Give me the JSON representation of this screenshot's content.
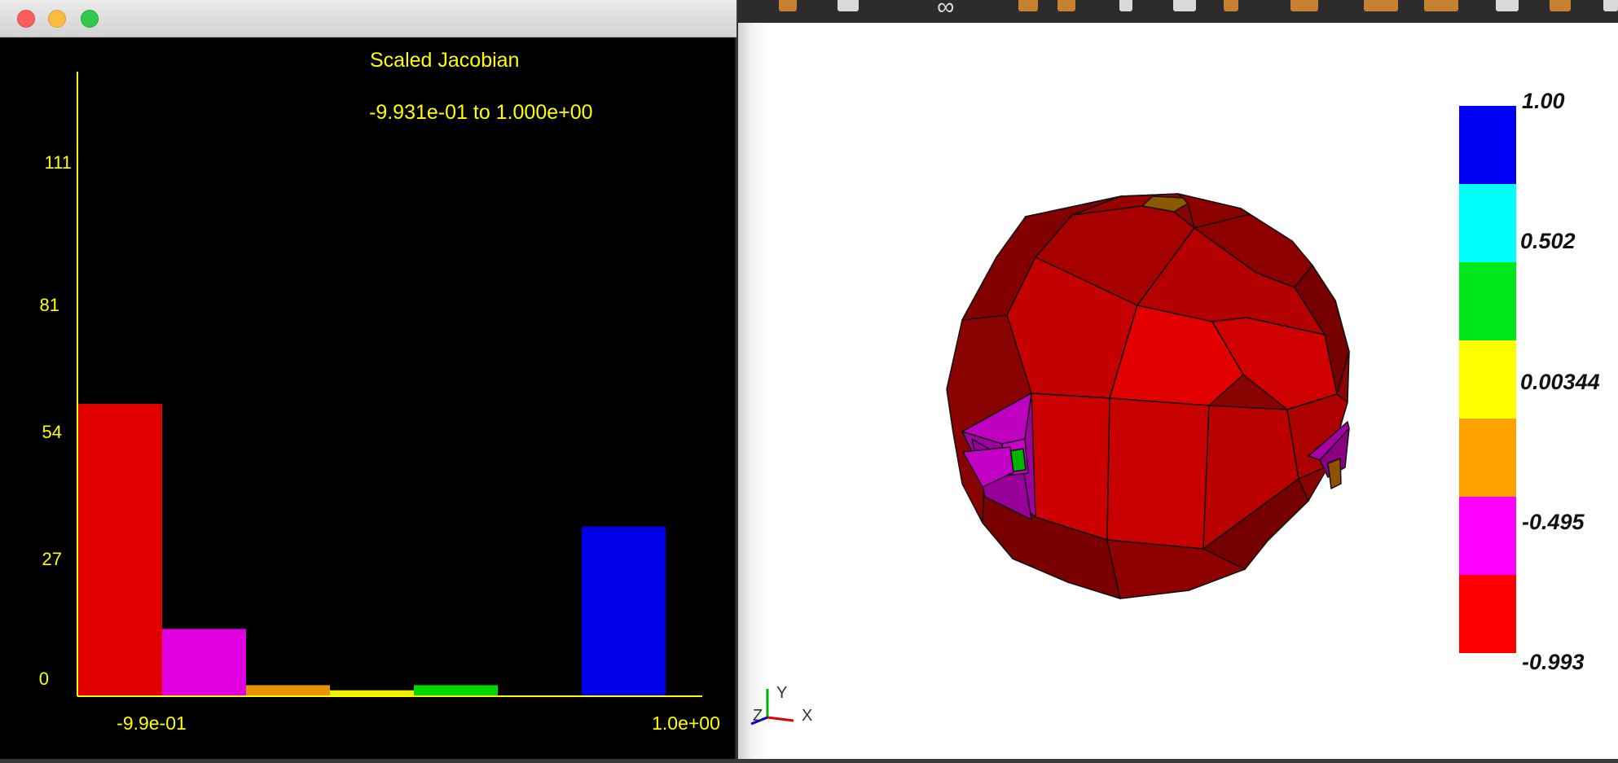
{
  "histogram_window": {
    "title_line1": "Scaled Jacobian",
    "title_line2": "-9.931e-01 to 1.000e+00",
    "y_ticks": [
      "111",
      "81",
      "54",
      "27",
      "0"
    ],
    "x_min_label": "-9.9e-01",
    "x_max_label": "1.0e+00",
    "controls": [
      "close",
      "minimize",
      "zoom"
    ]
  },
  "chart_data": {
    "type": "bar",
    "title": "Scaled Jacobian",
    "subtitle": "-9.931e-01 to 1.000e+00",
    "xlim": [
      -0.9931,
      1.0
    ],
    "y_tick_values": [
      0,
      27,
      54,
      81,
      111
    ],
    "bins": 7,
    "values": [
      57,
      13,
      2,
      1,
      2,
      0,
      33
    ],
    "colors": [
      "#e00000",
      "#e000e0",
      "#e69500",
      "#f0f000",
      "#00d800",
      "#000000",
      "#0000e8"
    ]
  },
  "color_legend": {
    "entries": [
      {
        "color": "#0000f5"
      },
      {
        "color": "#00ffff"
      },
      {
        "color": "#00e81c"
      },
      {
        "color": "#ffff00"
      },
      {
        "color": "#ffa200"
      },
      {
        "color": "#ff00ff"
      },
      {
        "color": "#ff0000"
      }
    ],
    "labels": [
      "1.00",
      "0.502",
      "0.00344",
      "-0.495",
      "-0.993"
    ]
  },
  "axes_triad": {
    "y": "Y",
    "z": "Z",
    "x": "X"
  },
  "toolbar": {
    "icons": [
      "infinity-icon",
      "tool-icon",
      "tool-icon",
      "tool-icon",
      "tool-icon",
      "tool-icon",
      "tool-icon",
      "tool-icon",
      "tool-icon",
      "tool-icon"
    ],
    "infinity_glyph": "∞"
  }
}
